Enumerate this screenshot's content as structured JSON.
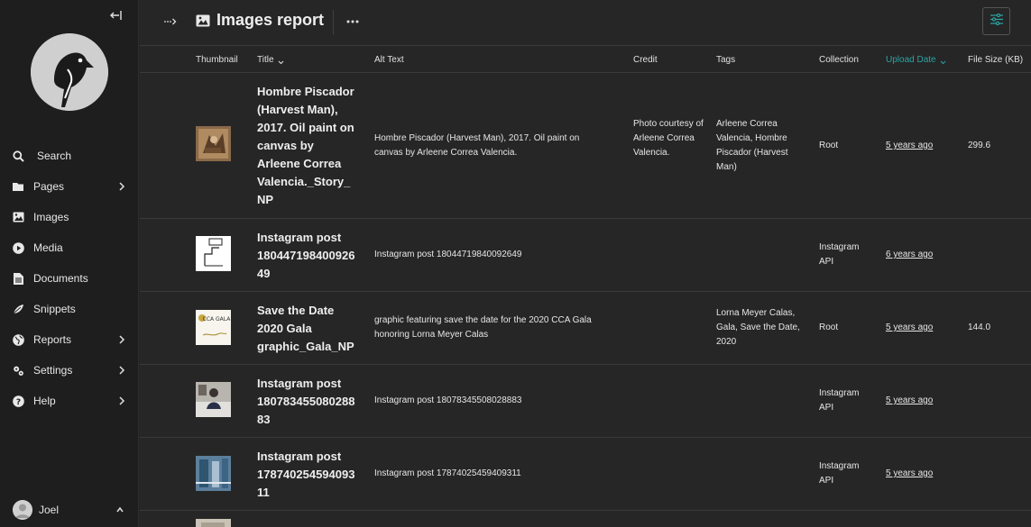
{
  "sidebar": {
    "items": [
      {
        "label": "Search",
        "icon": "search-icon",
        "has_submenu": false
      },
      {
        "label": "Pages",
        "icon": "folder-icon",
        "has_submenu": true
      },
      {
        "label": "Images",
        "icon": "image-icon",
        "has_submenu": false
      },
      {
        "label": "Media",
        "icon": "play-icon",
        "has_submenu": false
      },
      {
        "label": "Documents",
        "icon": "document-icon",
        "has_submenu": false
      },
      {
        "label": "Snippets",
        "icon": "snippet-icon",
        "has_submenu": false
      },
      {
        "label": "Reports",
        "icon": "globe-icon",
        "has_submenu": true
      },
      {
        "label": "Settings",
        "icon": "cogs-icon",
        "has_submenu": true
      },
      {
        "label": "Help",
        "icon": "help-icon",
        "has_submenu": true
      }
    ],
    "user": {
      "name": "Joel"
    }
  },
  "header": {
    "title": "Images report"
  },
  "table": {
    "columns": [
      "Thumbnail",
      "Title",
      "Alt Text",
      "Credit",
      "Tags",
      "Collection",
      "Upload Date",
      "File Size (KB)"
    ],
    "sorted_column": "Upload Date",
    "rows": [
      {
        "title": "Hombre Piscador (Harvest Man), 2017. Oil paint on canvas by Arleene Correa Valencia._Story_ NP",
        "alt": "Hombre Piscador (Harvest Man), 2017. Oil paint on canvas by Arleene Correa Valencia.",
        "credit": "Photo courtesy of Arleene Correa Valencia.",
        "tags": "Arleene Correa Valencia, Hombre Piscador (Harvest Man)",
        "collection": "Root",
        "date": "5 years ago",
        "size": "299.6"
      },
      {
        "title": "Instagram post 18044719840092649",
        "alt": "Instagram post 18044719840092649",
        "credit": "",
        "tags": "",
        "collection": "Instagram API",
        "date": "6 years ago",
        "size": ""
      },
      {
        "title": "Save the Date 2020 Gala graphic_Gala_NP",
        "alt": "graphic featuring save the date for the 2020 CCA Gala honoring Lorna Meyer Calas",
        "credit": "",
        "tags": "Lorna Meyer Calas, Gala, Save the Date, 2020",
        "collection": "Root",
        "date": "5 years ago",
        "size": "144.0"
      },
      {
        "title": "Instagram post 18078345508028883",
        "alt": "Instagram post 18078345508028883",
        "credit": "",
        "tags": "",
        "collection": "Instagram API",
        "date": "5 years ago",
        "size": ""
      },
      {
        "title": "Instagram post 17874025459409311",
        "alt": "Instagram post 17874025459409311",
        "credit": "",
        "tags": "",
        "collection": "Instagram API",
        "date": "5 years ago",
        "size": ""
      }
    ]
  },
  "colors": {
    "accent": "#2ba3a3",
    "background": "#262626",
    "sidebar": "#1e1e1e"
  }
}
